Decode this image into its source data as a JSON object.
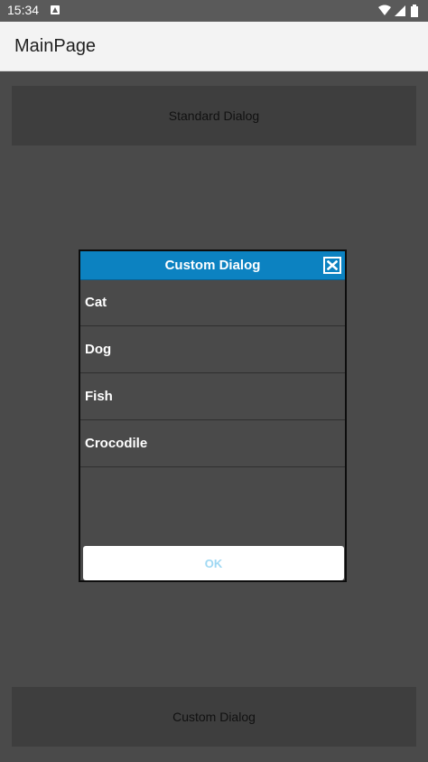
{
  "status_bar": {
    "time": "15:34",
    "icons": [
      "notification-icon",
      "wifi-icon",
      "signal-icon",
      "battery-icon"
    ]
  },
  "app_bar": {
    "title": "MainPage"
  },
  "page": {
    "standard_dialog_label": "Standard Dialog",
    "custom_dialog_label": "Custom Dialog"
  },
  "dialog": {
    "title": "Custom Dialog",
    "close_icon": "close-icon",
    "items": [
      {
        "label": "Cat"
      },
      {
        "label": "Dog"
      },
      {
        "label": "Fish"
      },
      {
        "label": "Crocodile"
      }
    ],
    "ok_label": "OK"
  },
  "colors": {
    "overlay": "#4a4a4a",
    "dialog_header": "#0c82c1",
    "ok_text": "#9fd8f3"
  }
}
